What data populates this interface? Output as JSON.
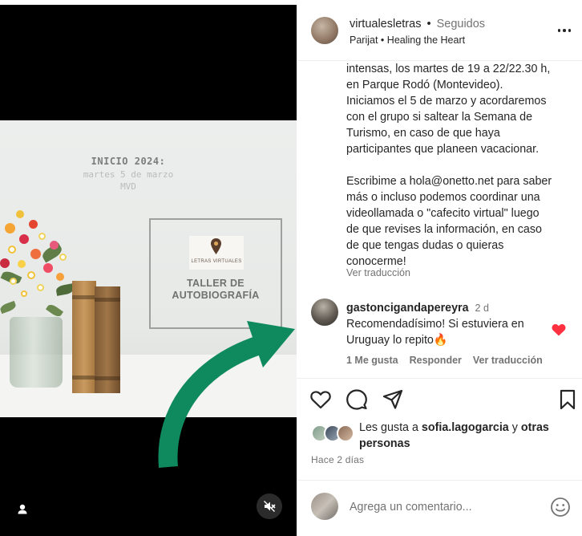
{
  "slide": {
    "inicio_title": "INICIO 2024:",
    "inicio_date": "martes 5 de marzo",
    "inicio_place": "MVD",
    "logo_text": "LETRAS VIRTUALES",
    "taller_line1": "TALLER DE",
    "taller_line2": "AUTOBIOGRAFÍA"
  },
  "header": {
    "username": "virtualesletras",
    "separator": "•",
    "follow_status": "Seguidos",
    "audio_artist": "Parijat",
    "audio_separator": "•",
    "audio_track": "Healing the Heart"
  },
  "caption": {
    "paragraph1": [
      "intensas, los martes de 19 a 22/22.30 h,",
      "en Parque Rodó (Montevideo).",
      "Iniciamos el 5 de marzo y acordaremos",
      "con el grupo si saltear la Semana de",
      "Turismo, en caso de que haya",
      "participantes que planeen vacacionar."
    ],
    "paragraph2": [
      "Escribime a hola@onetto.net para saber",
      "más o incluso podemos coordinar una",
      "videollamada o \"cafecito virtual\" luego",
      "de que revises la información, en caso",
      "de que tengas dudas o quieras",
      "conocerme!"
    ],
    "see_translation": "Ver traducción"
  },
  "comment": {
    "username": "gastoncigandapereyra",
    "time": "2 d",
    "text_line1": "Recomendadísimo! Si estuviera en",
    "text_line2": "Uruguay lo repito🔥",
    "likes": "1 Me gusta",
    "reply": "Responder",
    "see_translation": "Ver traducción"
  },
  "likes": {
    "prefix": "Les gusta a",
    "user": "sofia.lagogarcia",
    "conjunction": "y",
    "others": "otras personas"
  },
  "time_ago": "Hace 2 días",
  "add_comment": {
    "placeholder": "Agrega un comentario..."
  },
  "colors": {
    "arrow": "#0f8a5f",
    "heart": "#ff3040",
    "secondary_text": "#737373"
  },
  "icons": [
    "user-tag-icon",
    "mute-icon",
    "more-icon",
    "heart-icon",
    "comment-icon",
    "share-icon",
    "bookmark-icon",
    "emoji-icon"
  ]
}
